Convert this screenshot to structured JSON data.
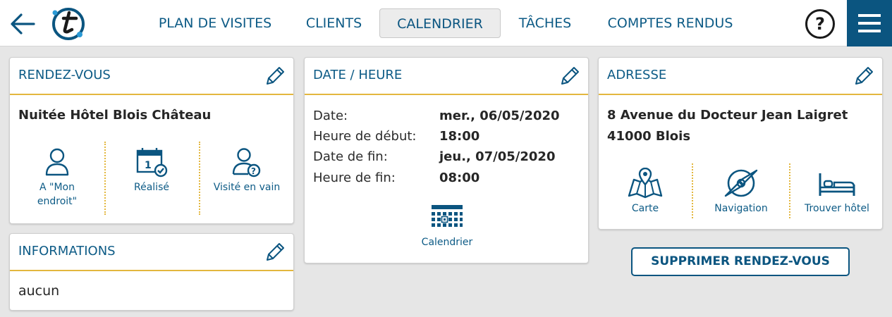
{
  "nav": {
    "items": [
      {
        "label": "PLAN DE VISITES"
      },
      {
        "label": "CLIENTS"
      },
      {
        "label": "CALENDRIER"
      },
      {
        "label": "TÂCHES"
      },
      {
        "label": "COMPTES RENDUS"
      }
    ],
    "active": "CALENDRIER",
    "help_label": "?"
  },
  "colors": {
    "accent": "#0b5580",
    "divider": "#e3b73e"
  },
  "appointment": {
    "title": "RENDEZ-VOUS",
    "name": "Nuitée Hôtel Blois Château",
    "actions": [
      {
        "label": "A \"Mon endroit\"",
        "icon": "person-icon"
      },
      {
        "label": "Réalisé",
        "icon": "calendar-check-icon"
      },
      {
        "label": "Visité en vain",
        "icon": "person-question-icon"
      }
    ]
  },
  "information": {
    "title": "INFORMATIONS",
    "value": "aucun"
  },
  "datetime": {
    "title": "DATE / HEURE",
    "rows": [
      {
        "label": "Date:",
        "value": "mer., 06/05/2020"
      },
      {
        "label": "Heure de début:",
        "value": "18:00"
      },
      {
        "label": "Date de fin:",
        "value": "jeu., 07/05/2020"
      },
      {
        "label": "Heure de fin:",
        "value": "08:00"
      }
    ],
    "calendar_label": "Calendrier"
  },
  "address": {
    "title": "ADRESSE",
    "line1": "8 Avenue du Docteur Jean Laigret",
    "line2": "41000 Blois",
    "actions": [
      {
        "label": "Carte",
        "icon": "map-icon"
      },
      {
        "label": "Navigation",
        "icon": "compass-icon"
      },
      {
        "label": "Trouver hôtel",
        "icon": "bed-icon"
      }
    ]
  },
  "delete_label": "SUPPRIMER RENDEZ-VOUS"
}
